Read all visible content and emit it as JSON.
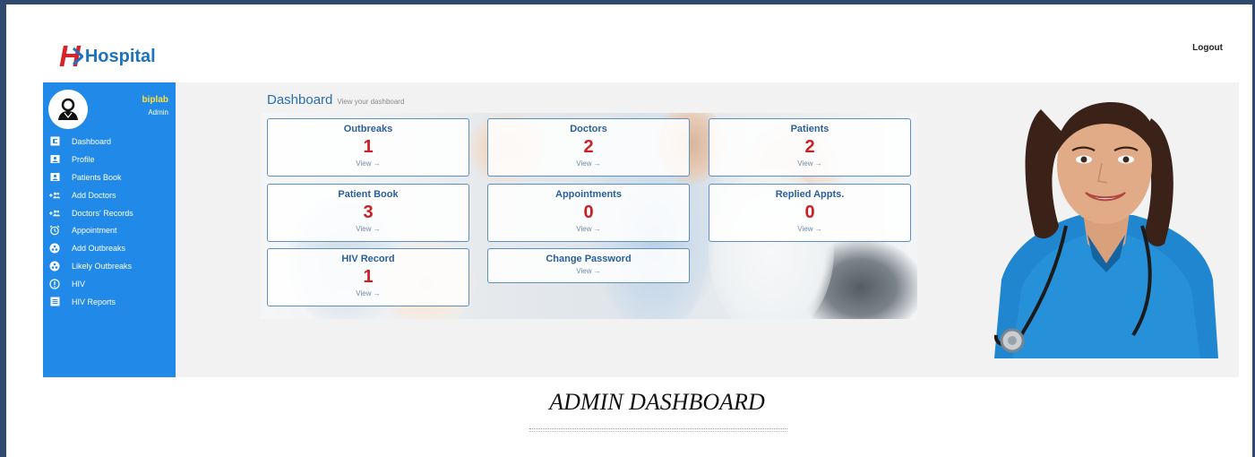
{
  "header": {
    "logo_text": "Hospital",
    "logout_label": "Logout"
  },
  "user": {
    "name": "biplab",
    "role": "Admin"
  },
  "sidebar": {
    "items": [
      {
        "label": "Dashboard",
        "icon": "dashboard-icon"
      },
      {
        "label": "Profile",
        "icon": "profile-card-icon"
      },
      {
        "label": "Patients Book",
        "icon": "patients-book-icon"
      },
      {
        "label": "Add Doctors",
        "icon": "add-users-icon"
      },
      {
        "label": "Doctors' Records",
        "icon": "users-icon"
      },
      {
        "label": "Appointment",
        "icon": "alarm-clock-icon"
      },
      {
        "label": "Add Outbreaks",
        "icon": "biohazard-icon"
      },
      {
        "label": "Likely Outbreaks",
        "icon": "biohazard-icon"
      },
      {
        "label": "HIV",
        "icon": "info-circle-icon"
      },
      {
        "label": "HIV Reports",
        "icon": "report-list-icon"
      }
    ]
  },
  "main": {
    "title": "Dashboard",
    "subtitle": "View your dashboard",
    "cards": [
      {
        "title": "Outbreaks",
        "count": "1",
        "view": "View →"
      },
      {
        "title": "Doctors",
        "count": "2",
        "view": "View →"
      },
      {
        "title": "Patients",
        "count": "2",
        "view": "View →"
      },
      {
        "title": "Patient Book",
        "count": "3",
        "view": "View →"
      },
      {
        "title": "Appointments",
        "count": "0",
        "view": "View →"
      },
      {
        "title": "Replied Appts.",
        "count": "0",
        "view": "View →"
      },
      {
        "title": "HIV Record",
        "count": "1",
        "view": "View →"
      },
      {
        "title": "Change Password",
        "count": "",
        "view": "View →"
      }
    ]
  },
  "caption": "ADMIN DASHBOARD",
  "colors": {
    "sidebar": "#2189e8",
    "accent": "#1e73be",
    "count_red": "#cc1f25",
    "username_yellow": "#ffe13a",
    "frame": "#2f4a6e"
  }
}
